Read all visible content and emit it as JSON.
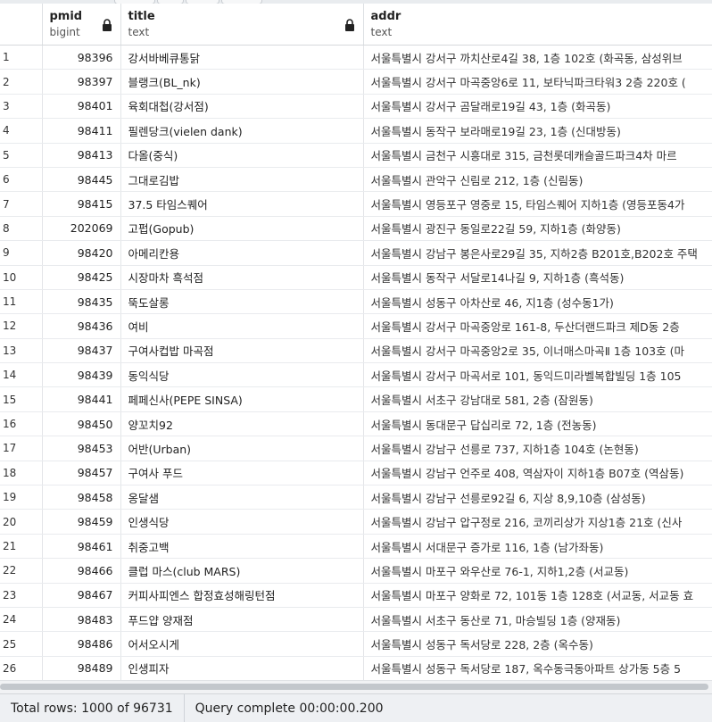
{
  "columns": [
    {
      "name": "pmid",
      "type": "bigint",
      "locked": true
    },
    {
      "name": "title",
      "type": "text",
      "locked": true
    },
    {
      "name": "addr",
      "type": "text",
      "locked": false
    }
  ],
  "rows": [
    {
      "n": "1",
      "pmid": "98396",
      "title": "강서바베큐통닭",
      "addr": "서울특별시 강서구 까치산로4길 38, 1층 102호 (화곡동, 삼성위브"
    },
    {
      "n": "2",
      "pmid": "98397",
      "title": "블랭크(BL_nk)",
      "addr": "서울특별시 강서구 마곡중앙6로 11, 보타닉파크타워3 2층 220호 ("
    },
    {
      "n": "3",
      "pmid": "98401",
      "title": "육회대첩(강서점)",
      "addr": "서울특별시 강서구 곰달래로19길 43, 1층 (화곡동)"
    },
    {
      "n": "4",
      "pmid": "98411",
      "title": "필렌당크(vielen dank)",
      "addr": "서울특별시 동작구 보라매로19길 23, 1층 (신대방동)"
    },
    {
      "n": "5",
      "pmid": "98413",
      "title": "다올(중식)",
      "addr": "서울특별시 금천구 시흥대로 315, 금천롯데캐슬골드파크4차 마르"
    },
    {
      "n": "6",
      "pmid": "98445",
      "title": "그대로김밥",
      "addr": "서울특별시 관악구 신림로 212, 1층 (신림동)"
    },
    {
      "n": "7",
      "pmid": "98415",
      "title": "37.5 타임스퀘어",
      "addr": "서울특별시 영등포구 영중로 15, 타임스퀘어 지하1층 (영등포동4가"
    },
    {
      "n": "8",
      "pmid": "202069",
      "title": "고펍(Gopub)",
      "addr": "서울특별시 광진구 동일로22길 59, 지하1층 (화양동)"
    },
    {
      "n": "9",
      "pmid": "98420",
      "title": "아메리칸용",
      "addr": "서울특별시 강남구 봉은사로29길 35, 지하2층 B201호,B202호 주택"
    },
    {
      "n": "10",
      "pmid": "98425",
      "title": "시장마차 흑석점",
      "addr": "서울특별시 동작구 서달로14나길 9, 지하1층 (흑석동)"
    },
    {
      "n": "11",
      "pmid": "98435",
      "title": "뚝도살롱",
      "addr": "서울특별시 성동구 아차산로 46, 지1층 (성수동1가)"
    },
    {
      "n": "12",
      "pmid": "98436",
      "title": "여비",
      "addr": "서울특별시 강서구 마곡중앙로 161-8, 두산더랜드파크 제D동 2층"
    },
    {
      "n": "13",
      "pmid": "98437",
      "title": "구여사컵밥 마곡점",
      "addr": "서울특별시 강서구 마곡중앙2로 35, 이너매스마곡Ⅱ 1층 103호 (마"
    },
    {
      "n": "14",
      "pmid": "98439",
      "title": "동익식당",
      "addr": "서울특별시 강서구 마곡서로 101, 동익드미라벨복합빌딩 1층 105"
    },
    {
      "n": "15",
      "pmid": "98441",
      "title": "페페신사(PEPE SINSA)",
      "addr": "서울특별시 서초구 강남대로 581, 2층 (잠원동)"
    },
    {
      "n": "16",
      "pmid": "98450",
      "title": "양꼬치92",
      "addr": "서울특별시 동대문구 답십리로 72, 1층 (전농동)"
    },
    {
      "n": "17",
      "pmid": "98453",
      "title": "어반(Urban)",
      "addr": "서울특별시 강남구 선릉로 737, 지하1층 104호 (논현동)"
    },
    {
      "n": "18",
      "pmid": "98457",
      "title": "구여사 푸드",
      "addr": "서울특별시 강남구 언주로 408, 역삼자이 지하1층 B07호 (역삼동)"
    },
    {
      "n": "19",
      "pmid": "98458",
      "title": "옹달샘",
      "addr": "서울특별시 강남구 선릉로92길 6, 지상 8,9,10층 (삼성동)"
    },
    {
      "n": "20",
      "pmid": "98459",
      "title": "인생식당",
      "addr": "서울특별시 강남구 압구정로 216, 코끼리상가 지상1층 21호 (신사"
    },
    {
      "n": "21",
      "pmid": "98461",
      "title": "취중고백",
      "addr": "서울특별시 서대문구 증가로 116, 1층 (남가좌동)"
    },
    {
      "n": "22",
      "pmid": "98466",
      "title": "클럽 마스(club MARS)",
      "addr": "서울특별시 마포구 와우산로 76-1, 지하1,2층 (서교동)"
    },
    {
      "n": "23",
      "pmid": "98467",
      "title": "커피사피엔스 합정효성해링턴점",
      "addr": "서울특별시 마포구 양화로 72, 101동 1층 128호 (서교동, 서교동 효"
    },
    {
      "n": "24",
      "pmid": "98483",
      "title": "푸드얍 양재점",
      "addr": "서울특별시 서초구 동산로 71, 마승빌딩 1층 (양재동)"
    },
    {
      "n": "25",
      "pmid": "98486",
      "title": "어서오시게",
      "addr": "서울특별시 성동구 독서당로 228, 2층 (옥수동)"
    },
    {
      "n": "26",
      "pmid": "98489",
      "title": "인생피자",
      "addr": "서울특별시 성동구 독서당로 187, 옥수동극동아파트 상가동 5층 5"
    }
  ],
  "status": {
    "total_rows": "Total rows: 1000 of 96731",
    "query": "Query complete 00:00:00.200"
  }
}
